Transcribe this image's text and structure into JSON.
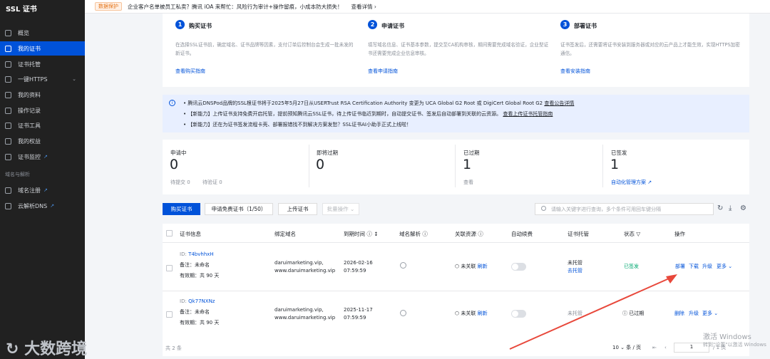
{
  "sidebar": {
    "title": "SSL 证书",
    "items": [
      {
        "label": "概览"
      },
      {
        "label": "我的证书"
      },
      {
        "label": "证书托管"
      },
      {
        "label": "一键HTTPS"
      },
      {
        "label": "我的资料"
      },
      {
        "label": "操作记录"
      },
      {
        "label": "证书工具"
      },
      {
        "label": "我的权益"
      },
      {
        "label": "证书监控"
      }
    ],
    "section_label": "域名与解析",
    "items2": [
      {
        "label": "域名注册"
      },
      {
        "label": "云解析DNS"
      }
    ]
  },
  "topbar": {
    "badge": "数据保护",
    "text": "企业客户名单被员工私卖？腾讯 iOA 来帮忙：风险行为审计+操作留痕，小成本防大损失！",
    "link": "查看详情 ›"
  },
  "steps": [
    {
      "num": "1",
      "title": "购买证书",
      "desc": "在选择SSL证书前，确定域名、证书品牌等因素，支付订单后控制台会生成一批未发的新证书。",
      "link": "查看购买指南"
    },
    {
      "num": "2",
      "title": "申请证书",
      "desc": "填写域名信息、证书基本参数，提交至CA机构审核，期间需要完成域名验证，企业型证书还需要完成企业信息审核。",
      "link": "查看申请指南"
    },
    {
      "num": "3",
      "title": "部署证书",
      "desc": "证书签发后，还需要将证书安装到服务器或对应的云产品上才能生效，实现HTTPS加密通信。",
      "link": "查看安装指南"
    }
  ],
  "notices": [
    {
      "text": "• 腾讯云DNSPod品牌的SSL根证书将于2025年5月27日从USERTrust RSA Certification Authority 变更为 UCA Global G2 Root 或 DigiCert Global Root G2",
      "link": "查看公告详情"
    },
    {
      "text": "• 【新能力】上传证书支持免费开启托管，提前预知腾讯云SSL证书，待上传证书临近到期时，自动提交证书、签发后自动部署到关联的云资源。",
      "link": "查看上传证书托管指南"
    },
    {
      "text": "• 【新能力】还在为证书签发流程卡壳、部署报错找不到解决方案发愁？SSL证书AI小助手正式上线啦！",
      "link": ""
    }
  ],
  "stats": [
    {
      "label": "申请中",
      "value": "0",
      "sub1": "待提交 0",
      "sub2": "待验证 0"
    },
    {
      "label": "即将过期",
      "value": "0",
      "sub1": "",
      "sub2": ""
    },
    {
      "label": "已过期",
      "value": "1",
      "sub1": "查看",
      "sub2": ""
    },
    {
      "label": "已签发",
      "value": "1",
      "sub1": "自动化管理方案",
      "sub2": ""
    }
  ],
  "toolbar": {
    "buy": "购买证书",
    "apply_free": "申请免费证书（1/50）",
    "upload": "上传证书",
    "batch": "批量操作",
    "search_placeholder": "请输入关键字进行查询，多个条件可用回车键分隔"
  },
  "table": {
    "headers": [
      "证书信息",
      "绑定域名",
      "到期时间",
      "域名解析",
      "关联资源",
      "自动续费",
      "证书托管",
      "状态",
      "操作"
    ],
    "rows": [
      {
        "id_label": "ID:",
        "id": "T4bvhhxH",
        "remark": "备注：未命名",
        "valid": "有效期：共 90 天",
        "domain1": "daruimarketing.vip,",
        "domain2": "www.daruimarketing.vip",
        "date": "2026-02-16",
        "time": "07:59:59",
        "res": "未关联",
        "res_link": "刷新",
        "host1": "未托管",
        "host2": "去托管",
        "status": "已签发",
        "ops": [
          "部署",
          "下载",
          "升级",
          "更多"
        ]
      },
      {
        "id_label": "ID:",
        "id": "Qk77NXNz",
        "remark": "备注：未命名",
        "valid": "有效期：共 90 天",
        "domain1": "daruimarketing.vip,",
        "domain2": "www.daruimarketing.vip",
        "date": "2025-11-17",
        "time": "07:59:59",
        "res": "未关联",
        "res_link": "刷新",
        "host1": "未托管",
        "host2": "",
        "status": "已过期",
        "ops": [
          "删除",
          "升级",
          "更多"
        ]
      }
    ]
  },
  "footer": {
    "total": "共 2 条",
    "page_size": "10",
    "per_page": "条 / 页",
    "page": "1",
    "pages": "/ 1 页"
  },
  "watermark": {
    "logo": "大数跨境",
    "win1": "激活 Windows",
    "win2": "转到\"设置\"以激活 Windows"
  },
  "colors": {
    "brand": "#0052d9",
    "sidebar": "#212121",
    "success": "#00a870",
    "annotation": "#e8483b"
  }
}
